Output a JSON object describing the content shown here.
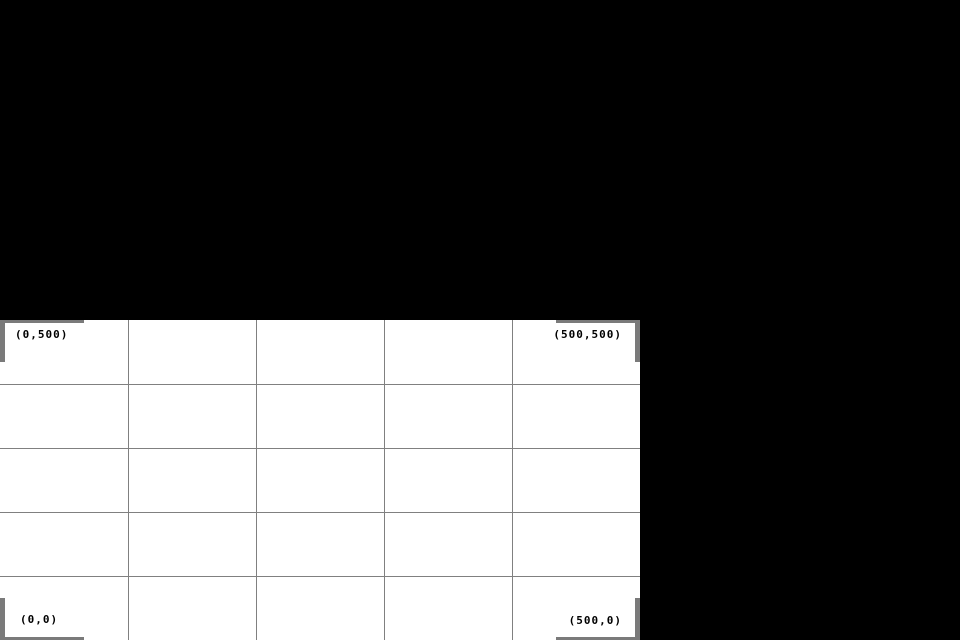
{
  "colors": {
    "background": "#000000",
    "panel": "#ffffff",
    "grid_line": "#808080",
    "corner_marker": "#7a7a7a",
    "label_text": "#000000"
  },
  "grid": {
    "columns": 5,
    "rows": 5
  },
  "corners": {
    "top_left": "(0,500)",
    "top_right": "(500,500)",
    "bottom_left": "(0,0)",
    "bottom_right": "(500,0)"
  }
}
